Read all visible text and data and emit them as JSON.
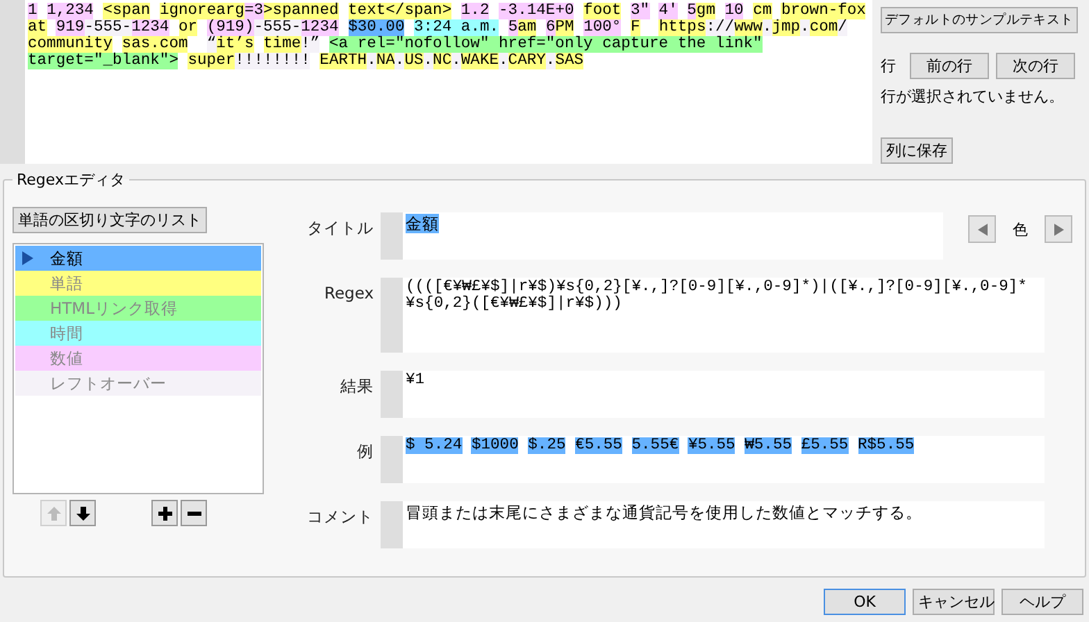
{
  "sample_text": {
    "lines": [
      [
        {
          "text": "1 ",
          "color": "#f9ccff"
        },
        {
          "text": "1,234 ",
          "color": "#f9ccff"
        },
        {
          "text": "<span ",
          "color": "#ffff80"
        },
        {
          "text": "ignorearg",
          "color": "#ffff80"
        },
        {
          "text": "=3",
          "color": "#f9ccff"
        },
        {
          "text": ">spanned ",
          "color": "#ffff80"
        },
        {
          "text": "text",
          "color": "#ffff80"
        },
        {
          "text": "</span> ",
          "color": "#ffff80"
        },
        {
          "text": "1.2 ",
          "color": "#f9ccff"
        },
        {
          "text": "-3.14E+0 ",
          "color": "#f9ccff"
        },
        {
          "text": "foot ",
          "color": "#ffff80"
        },
        {
          "text": "3″ ",
          "color": "#f9ccff"
        },
        {
          "text": "4′ ",
          "color": "#f9ccff"
        },
        {
          "text": "5",
          "color": "#f9ccff"
        },
        {
          "text": "gm ",
          "color": "#ffff80"
        },
        {
          "text": "10 ",
          "color": "#f9ccff"
        },
        {
          "text": "cm ",
          "color": "#ffff80"
        },
        {
          "text": "brown-fox",
          "color": "#ffff80"
        }
      ],
      [
        {
          "text": "at ",
          "color": "#ffff80"
        },
        {
          "text": "919",
          "color": "#f9ccff"
        },
        {
          "text": "-555-",
          "color": "#f5f2f8"
        },
        {
          "text": "1234 ",
          "color": "#f9ccff"
        },
        {
          "text": "or ",
          "color": "#ffff80"
        },
        {
          "text": "(919)",
          "color": "#f9ccff"
        },
        {
          "text": "-555-",
          "color": "#f5f2f8"
        },
        {
          "text": "1234 ",
          "color": "#f9ccff"
        },
        {
          "text": "$30.00 ",
          "color": "#66b2ff"
        },
        {
          "text": "3:24 a.m. ",
          "color": "#99ffff"
        },
        {
          "text": "5",
          "color": "#f9ccff"
        },
        {
          "text": "am ",
          "color": "#ffff80"
        },
        {
          "text": "6",
          "color": "#f9ccff"
        },
        {
          "text": "PM ",
          "color": "#ffff80"
        },
        {
          "text": "100° ",
          "color": "#f9ccff"
        },
        {
          "text": "F  ",
          "color": "#ffff80"
        },
        {
          "text": "https",
          "color": "#ffff80"
        },
        {
          "text": "://",
          "color": "#f5f2f8"
        },
        {
          "text": "www",
          "color": "#ffff80"
        },
        {
          "text": ".",
          "color": "#f5f2f8"
        },
        {
          "text": "jmp",
          "color": "#ffff80"
        },
        {
          "text": ".",
          "color": "#f5f2f8"
        },
        {
          "text": "com",
          "color": "#ffff80"
        },
        {
          "text": "/",
          "color": "#f5f2f8"
        }
      ],
      [
        {
          "text": "community ",
          "color": "#ffff80"
        },
        {
          "text": "sas.com  ",
          "color": "#ffff80"
        },
        {
          "text": "“",
          "color": "#f5f2f8"
        },
        {
          "text": "it’s ",
          "color": "#ffff80"
        },
        {
          "text": "time",
          "color": "#ffff80"
        },
        {
          "text": "!” ",
          "color": "#f5f2f8"
        },
        {
          "text": "<a rel=\"nofollow\" href=\"only capture the link\"",
          "color": "#99ff99"
        }
      ],
      [
        {
          "text": "target=\"_blank\"> ",
          "color": "#99ff99"
        },
        {
          "text": "super",
          "color": "#ffff80"
        },
        {
          "text": "!!!!!!!! ",
          "color": "#f5f2f8"
        },
        {
          "text": "EARTH",
          "color": "#ffff80"
        },
        {
          "text": ".",
          "color": "#f5f2f8"
        },
        {
          "text": "NA",
          "color": "#ffff80"
        },
        {
          "text": ".",
          "color": "#f5f2f8"
        },
        {
          "text": "US",
          "color": "#ffff80"
        },
        {
          "text": ".",
          "color": "#f5f2f8"
        },
        {
          "text": "NC",
          "color": "#ffff80"
        },
        {
          "text": ".",
          "color": "#f5f2f8"
        },
        {
          "text": "WAKE",
          "color": "#ffff80"
        },
        {
          "text": ".",
          "color": "#f5f2f8"
        },
        {
          "text": "CARY",
          "color": "#ffff80"
        },
        {
          "text": ".",
          "color": "#f5f2f8"
        },
        {
          "text": "SAS",
          "color": "#ffff80"
        }
      ]
    ]
  },
  "side_panel": {
    "default_button": "デフォルトのサンプルテキスト",
    "row_label": "行",
    "prev_button": "前の行",
    "next_button": "次の行",
    "row_status": "行が選択されていません。",
    "save_button": "列に保存"
  },
  "editor": {
    "title": "Regexエディタ",
    "delimiters_button": "単語の区切り文字のリスト",
    "items": [
      {
        "name": "金額",
        "color": "#66b2ff",
        "selected": true
      },
      {
        "name": "単語",
        "color": "#ffff80",
        "selected": false
      },
      {
        "name": "HTMLリンク取得",
        "color": "#99ff99",
        "selected": false
      },
      {
        "name": "時間",
        "color": "#99ffff",
        "selected": false
      },
      {
        "name": "数値",
        "color": "#f9ccff",
        "selected": false
      },
      {
        "name": "レフトオーバー",
        "color": "#f5f2f8",
        "selected": false
      }
    ],
    "move_up": {
      "disabled": true
    },
    "move_down": {
      "disabled": false
    },
    "fields": {
      "title_label": "タイトル",
      "title_value": "金額",
      "color_label": "色",
      "regex_label": "Regex",
      "regex_value": "((([€¥₩£¥$]|r¥$)¥s{0,2}[¥.,]?[0-9][¥.,0-9]*)|([¥.,]?[0-9][¥.,0-9]*¥s{0,2}([€¥₩£¥$]|r¥$)))",
      "result_label": "結果",
      "result_value": "¥1",
      "example_label": "例",
      "example_matches": [
        "$ 5.24",
        "$1000",
        "$.25",
        "€5.55",
        "5.55€",
        "¥5.55",
        "₩5.55",
        "£5.55",
        "R$5.55"
      ],
      "comment_label": "コメント",
      "comment_value": "冒頭または末尾にさまざまな通貨記号を使用した数値とマッチする。"
    }
  },
  "buttons": [
    "OK",
    "キャンセル",
    "ヘルプ"
  ]
}
